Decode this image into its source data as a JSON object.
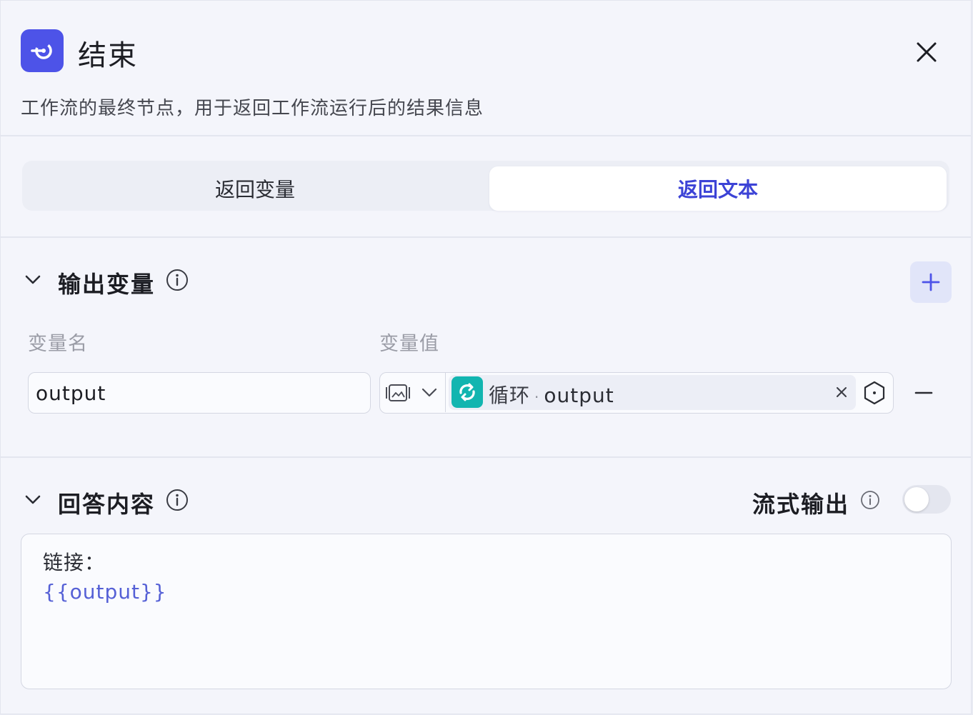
{
  "header": {
    "title": "结束",
    "description": "工作流的最终节点，用于返回工作流运行后的结果信息"
  },
  "tabs": {
    "items": [
      "返回变量",
      "返回文本"
    ],
    "active": "返回文本"
  },
  "output_section": {
    "title": "输出变量",
    "col_name_label": "变量名",
    "col_value_label": "变量值",
    "row": {
      "name": "output",
      "ref_node": "循环",
      "ref_separator": "·",
      "ref_var": "output"
    }
  },
  "answer_section": {
    "title": "回答内容",
    "stream_label": "流式输出",
    "stream_enabled": false,
    "content_line1": "链接：",
    "content_line2": "{{output}}"
  },
  "colors": {
    "accent": "#4d53e8",
    "active_tab_text": "#3c43d6",
    "loop_icon_bg": "#12b5b0",
    "variable_text": "#5560d6"
  },
  "icons": {
    "node": "end-node-icon",
    "close": "close-icon",
    "collapse": "chevron-down-icon",
    "info": "info-icon",
    "add": "plus-icon",
    "type": "image-type-icon",
    "loop": "loop-icon",
    "clear": "clear-x-icon",
    "settings": "hexagon-settings-icon",
    "remove": "minus-icon"
  }
}
